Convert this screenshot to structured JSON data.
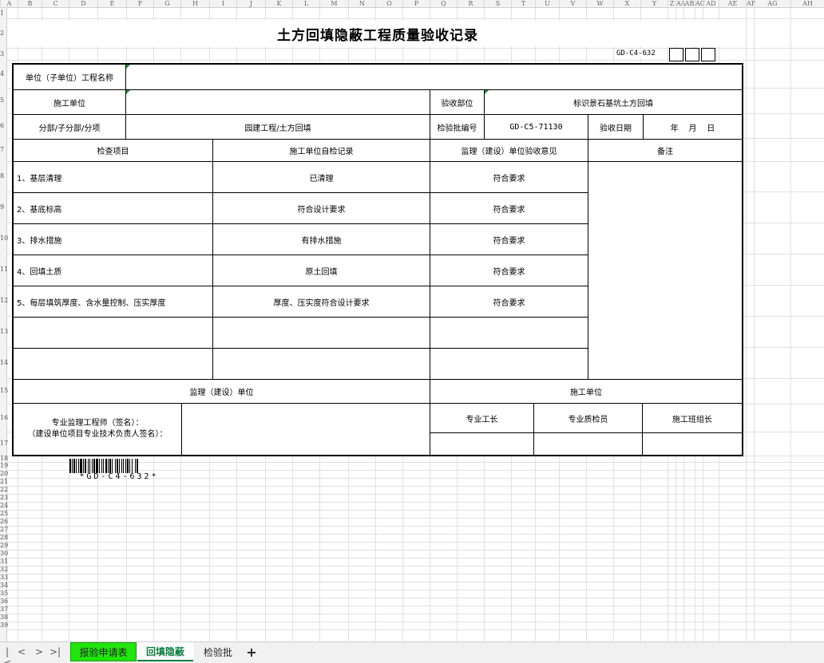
{
  "columns": [
    "A",
    "B",
    "C",
    "D",
    "E",
    "F",
    "G",
    "H",
    "I",
    "J",
    "K",
    "L",
    "M",
    "N",
    "O",
    "P",
    "Q",
    "R",
    "S",
    "T",
    "U",
    "V",
    "W",
    "X",
    "Y",
    "Z",
    "AA",
    "AB",
    "AC",
    "AD",
    "AE",
    "AF",
    "AG",
    "AH"
  ],
  "rows": [
    "1",
    "2",
    "3",
    "4",
    "5",
    "6",
    "7",
    "8",
    "9",
    "10",
    "11",
    "12",
    "13",
    "14",
    "15",
    "16",
    "17",
    "18",
    "19",
    "20",
    "21",
    "22",
    "23",
    "24",
    "25",
    "26",
    "27",
    "28",
    "29",
    "30",
    "31",
    "32",
    "33",
    "34",
    "35",
    "36",
    "37",
    "38",
    "39"
  ],
  "form": {
    "title": "土方回填隐蔽工程质量验收记录",
    "code": "GD-C4-632",
    "row_unit": {
      "label": "单位（子单位）工程名称",
      "value": ""
    },
    "row_contractor": {
      "label": "施工单位",
      "value": "",
      "part_label": "验收部位",
      "part_value": "标识景石基坑土方回填"
    },
    "row_sub": {
      "label": "分部/子分部/分项",
      "value": "园建工程/土方回填",
      "batch_label": "检验批编号",
      "batch_value": "GD-C5-71130",
      "date_label": "验收日期",
      "date_value": "年    月    日"
    },
    "headers": {
      "item": "检查项目",
      "self_check": "施工单位自检记录",
      "supervision": "监理（建设）单位验收意见",
      "remarks": "备注"
    },
    "items": [
      {
        "item": "1、基层清理",
        "self_check": "已清理",
        "supervision": "符合要求"
      },
      {
        "item": "2、基底标高",
        "self_check": "符合设计要求",
        "supervision": "符合要求"
      },
      {
        "item": "3、排水措施",
        "self_check": "有排水措施",
        "supervision": "符合要求"
      },
      {
        "item": "4、回填土质",
        "self_check": "原土回填",
        "supervision": "符合要求"
      },
      {
        "item": "5、每层填筑厚度、含水量控制、压实厚度",
        "self_check": "厚度、压实度符合设计要求",
        "supervision": "符合要求"
      },
      {
        "item": "",
        "self_check": "",
        "supervision": ""
      },
      {
        "item": "",
        "self_check": "",
        "supervision": ""
      }
    ],
    "sign": {
      "supervision_unit": "监理（建设）单位",
      "construction_unit": "施工单位",
      "engineer_line1": "专业监理工程师（签名）：",
      "engineer_line2": "（建设单位项目专业技术负责人签名）：",
      "foreman": "专业工长",
      "inspector": "专业质检员",
      "team_leader": "施工班组长"
    },
    "barcode_text": "*GD-C4-632*"
  },
  "tabs": [
    {
      "label": "报验申请表",
      "color": "#22e40f"
    },
    {
      "label": "回填隐蔽",
      "active": true
    },
    {
      "label": "检验批"
    }
  ],
  "tab_add_label": "+"
}
